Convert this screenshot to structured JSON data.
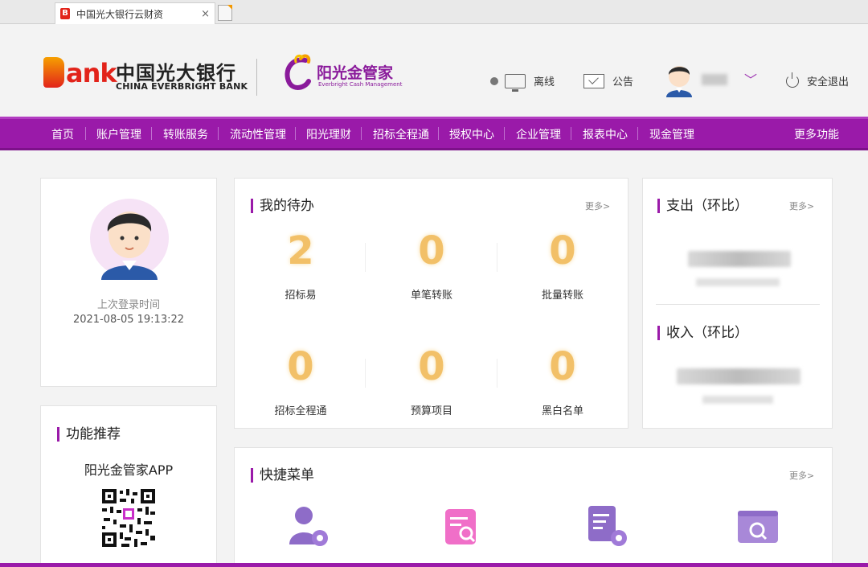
{
  "browser": {
    "tab_title": "中国光大银行云财资",
    "tab_close": "×",
    "favicon": "B"
  },
  "header": {
    "bank_logo_letter": "B",
    "bank_logo_rest": "ank",
    "bank_name_cn": "中国光大银行",
    "bank_name_en": "CHINA EVERBRIGHT BANK",
    "sub_brand_cn": "阳光金管家",
    "sub_brand_en": "Everbright Cash Management",
    "offline_label": "离线",
    "notice_label": "公告",
    "logout_label": "安全退出",
    "caret": "﹀"
  },
  "nav": {
    "items": [
      "首页",
      "账户管理",
      "转账服务",
      "流动性管理",
      "阳光理财",
      "招标全程通",
      "授权中心",
      "企业管理",
      "报表中心",
      "现金管理"
    ],
    "more": "更多功能"
  },
  "profile": {
    "last_login_label": "上次登录时间",
    "last_login_time": "2021-08-05 19:13:22"
  },
  "todo": {
    "title": "我的待办",
    "more": "更多>",
    "items": [
      {
        "count": "2",
        "label": "招标易"
      },
      {
        "count": "0",
        "label": "单笔转账"
      },
      {
        "count": "0",
        "label": "批量转账"
      },
      {
        "count": "0",
        "label": "招标全程通"
      },
      {
        "count": "0",
        "label": "预算项目"
      },
      {
        "count": "0",
        "label": "黑白名单"
      }
    ]
  },
  "finance": {
    "expense_title": "支出（环比）",
    "income_title": "收入（环比）",
    "more": "更多>"
  },
  "recommend": {
    "title": "功能推荐",
    "app_name": "阳光金管家APP"
  },
  "quick_menu": {
    "title": "快捷菜单",
    "more": "更多>"
  },
  "colors": {
    "brand_purple": "#9a1aa9",
    "bank_red": "#e2231a",
    "todo_number": "#f2c068"
  }
}
